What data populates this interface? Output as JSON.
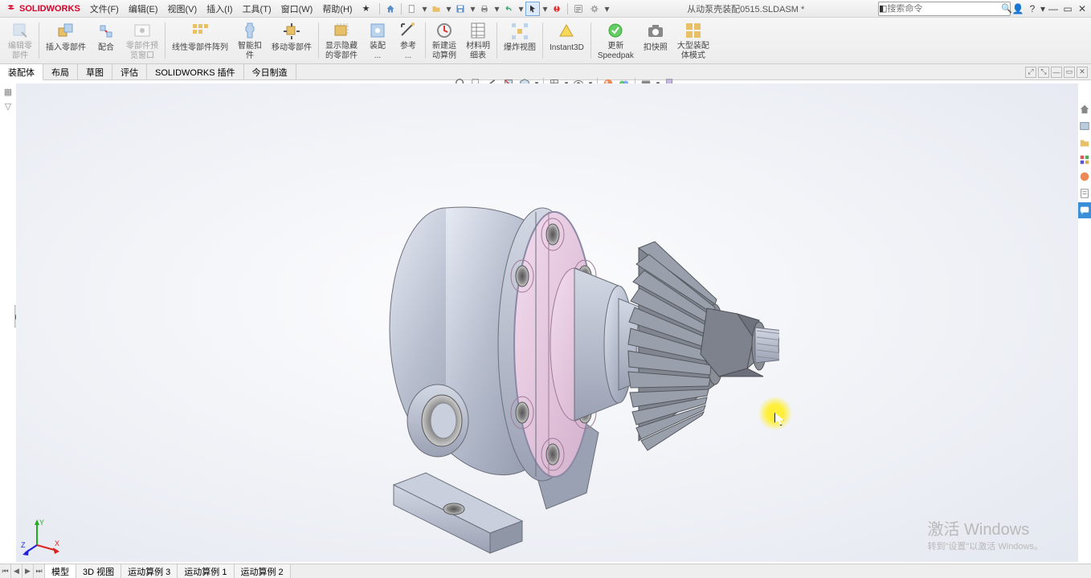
{
  "app": {
    "logo_text": "SOLIDWORKS"
  },
  "menu": {
    "file": "文件(F)",
    "edit": "编辑(E)",
    "view": "视图(V)",
    "insert": "插入(I)",
    "tools": "工具(T)",
    "window": "窗口(W)",
    "help": "帮助(H)",
    "star": "★"
  },
  "document_title": "从动泵壳装配0515.SLDASM *",
  "search": {
    "placeholder": "搜索命令"
  },
  "ribbon": {
    "edit_part": "编辑零\n部件",
    "insert_parts": "插入零部件",
    "mate": "配合",
    "part_preview": "零部件预\n览窗口",
    "linear_pattern": "线性零部件阵列",
    "smart_fastener": "智能扣\n件",
    "move_part": "移动零部件",
    "toggle_parts": "显示隐藏\n的零部件",
    "assembly_features": "装配\n...",
    "reference": "参考\n...",
    "new_motion": "新建运\n动算例",
    "bom": "材料明\n细表",
    "explode": "爆炸视图",
    "instant3d": "Instant3D",
    "update_speedpak": "更新\nSpeedpak",
    "snapshot": "扣快照",
    "large_assembly": "大型装配\n体模式"
  },
  "tabs": {
    "asm": "装配体",
    "layout": "布局",
    "sketch": "草图",
    "evaluate": "评估",
    "sw_addins": "SOLIDWORKS 插件",
    "sheetmetal": "今日制造"
  },
  "sheet_tabs": {
    "model": "模型",
    "view3d": "3D 视图",
    "motion3": "运动算例 3",
    "motion1": "运动算例 1",
    "motion2": "运动算例 2"
  },
  "watermark": {
    "title": "激活 Windows",
    "sub": "转到\"设置\"以激活 Windows。"
  },
  "colors": {
    "accent": "#d9002a",
    "steel": "#AEB5C6",
    "steel_face": "#C9CFDD",
    "pink_face": "#E8C9E0",
    "pink_side": "#D2AFCB",
    "gear": "#8A8E97",
    "screw": "#9AA1B0"
  }
}
